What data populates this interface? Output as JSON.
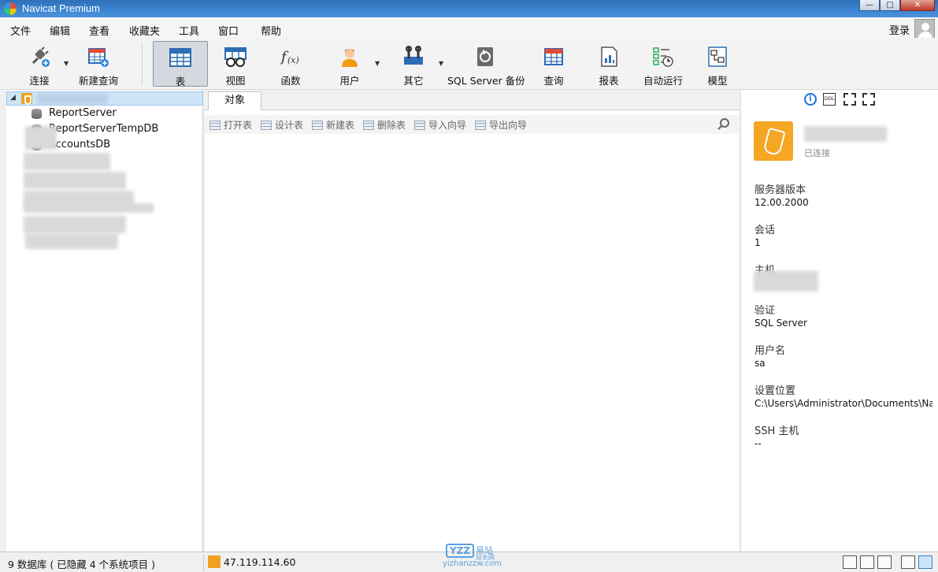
{
  "window": {
    "title": "Navicat Premium",
    "min": "—",
    "max": "□",
    "close": "✕"
  },
  "menu": {
    "items": [
      "文件",
      "编辑",
      "查看",
      "收藏夹",
      "工具",
      "窗口",
      "帮助"
    ],
    "login": "登录"
  },
  "toolbar": {
    "connect": "连接",
    "new_query": "新建查询",
    "table": "表",
    "view": "视图",
    "function": "函数",
    "user": "用户",
    "other": "其它",
    "backup": "SQL Server 备份",
    "query": "查询",
    "report": "报表",
    "automation": "自动运行",
    "model": "模型",
    "active": "table"
  },
  "tree": {
    "databases": [
      "ReportServer",
      "ReportServerTempDB",
      "AccountsDB"
    ]
  },
  "object_panel": {
    "tab": "对象",
    "actions": [
      "打开表",
      "设计表",
      "新建表",
      "删除表",
      "导入向导",
      "导出向导"
    ]
  },
  "info_panel": {
    "status": "已连接",
    "fields": [
      {
        "label": "服务器版本",
        "value": "12.00.2000"
      },
      {
        "label": "会话",
        "value": "1"
      },
      {
        "label": "主机",
        "value": ""
      },
      {
        "label": "验证",
        "value": "SQL Server"
      },
      {
        "label": "用户名",
        "value": "sa"
      },
      {
        "label": "设置位置",
        "value": "C:\\Users\\Administrator\\Documents\\Na"
      },
      {
        "label": "SSH 主机",
        "value": "--"
      }
    ]
  },
  "statusbar": {
    "left": "9 数据库 ( 已隐藏 4 个系统项目 )",
    "connection_ip": "47.119.114.60"
  },
  "watermark": {
    "logo": "YZZ",
    "cn": "易站",
    "sub": "站长网",
    "url": "yizhanzzw.com"
  },
  "colors": {
    "accent": "#2e6db4",
    "selection": "#cde4f7",
    "server_badge": "#f5a623"
  }
}
